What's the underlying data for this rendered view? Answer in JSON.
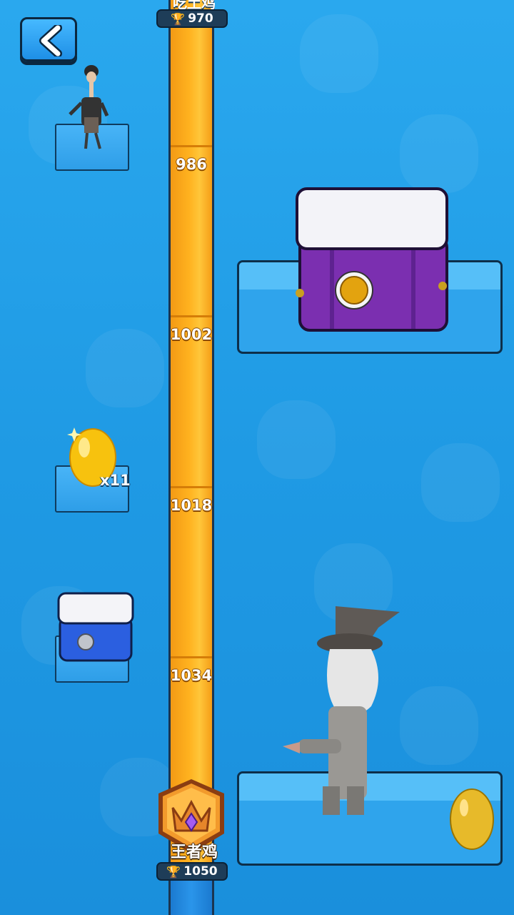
{
  "header": {
    "back_button": "back",
    "top_rank_name": "吃土鸡",
    "top_trophies": "970"
  },
  "track": {
    "ticks": [
      {
        "label": "986"
      },
      {
        "label": "1002"
      },
      {
        "label": "1018"
      },
      {
        "label": "1034"
      }
    ],
    "rank_badge": {
      "name": "王者鸡",
      "trophies": "1050"
    }
  },
  "rewards": {
    "golden_eggs_count": "x11"
  },
  "colors": {
    "track_orange": "#ffb21f",
    "card_blue": "#2fa4ec",
    "trophy_gold": "#ffc229"
  },
  "icons": [
    "back-arrow-icon",
    "trophy-icon",
    "crown-badge-icon"
  ]
}
